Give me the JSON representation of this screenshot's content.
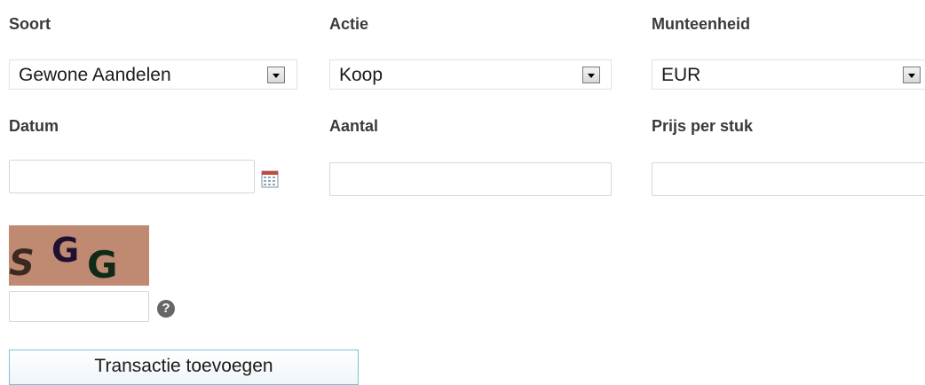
{
  "labels": {
    "soort": "Soort",
    "actie": "Actie",
    "munteenheid": "Munteenheid",
    "datum": "Datum",
    "aantal": "Aantal",
    "prijs": "Prijs per stuk"
  },
  "selects": {
    "soort": "Gewone Aandelen",
    "actie": "Koop",
    "munteenheid": "EUR"
  },
  "captcha": {
    "chars": [
      "S",
      "G",
      "G"
    ],
    "colors": [
      "#3a2a20",
      "#1e1030",
      "#0f2a18"
    ],
    "background": "#c08a72"
  },
  "icons": {
    "calendar": "calendar-icon",
    "help": "question-mark-icon",
    "help_glyph": "?"
  },
  "button": {
    "submit": "Transactie toevoegen"
  }
}
